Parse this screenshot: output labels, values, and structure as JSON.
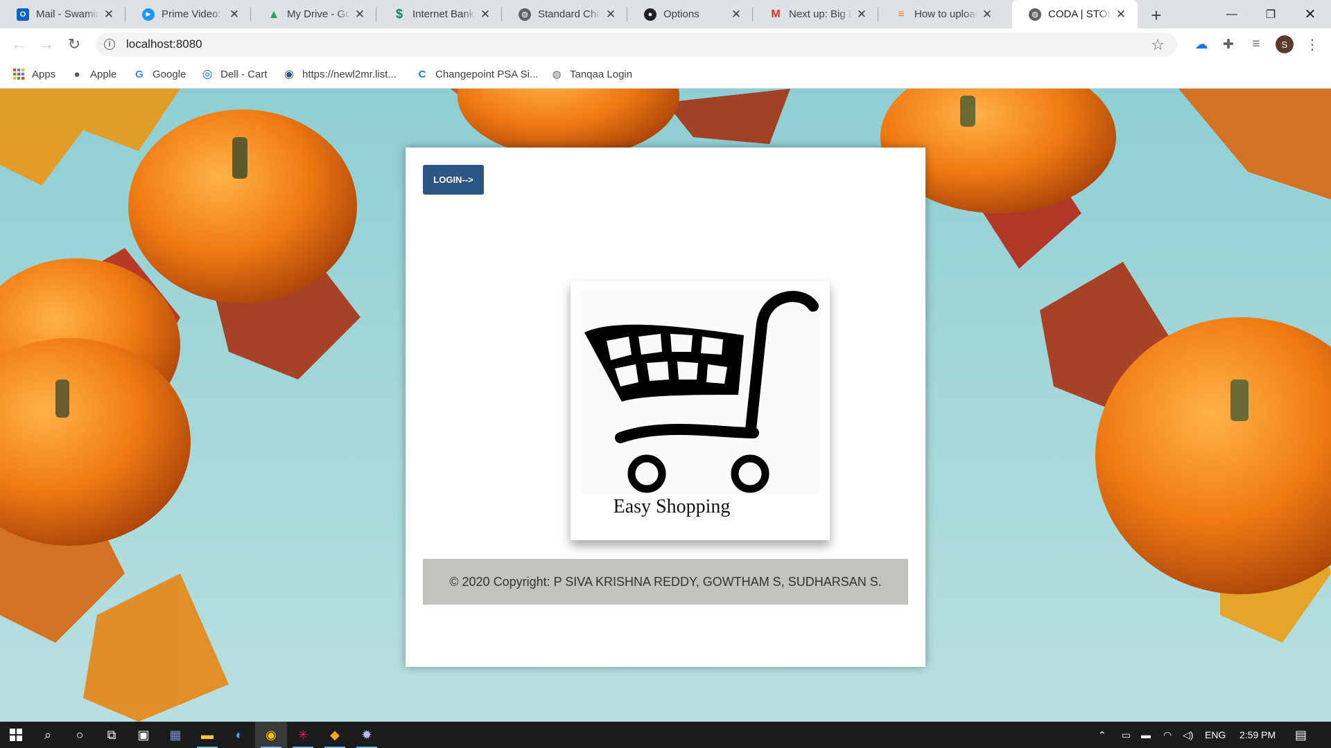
{
  "tabs": [
    {
      "title": "Mail - Swaminathan",
      "icon": "outlook-icon",
      "color": "#0a64c2",
      "glyph": "O"
    },
    {
      "title": "Prime Video: The",
      "icon": "prime-video-icon",
      "color": "#1a98ff",
      "glyph": "▶"
    },
    {
      "title": "My Drive - Google",
      "icon": "google-drive-icon",
      "color": "#1fa463",
      "glyph": "▲"
    },
    {
      "title": "Internet Banking",
      "icon": "bank-icon",
      "color": "#0a8a5a",
      "glyph": "S"
    },
    {
      "title": "Standard Chartered",
      "icon": "globe-icon",
      "color": "#5f6368",
      "glyph": "◍"
    },
    {
      "title": "Options",
      "icon": "github-icon",
      "color": "#202124",
      "glyph": "●"
    },
    {
      "title": "Next up: Big Data",
      "icon": "gmail-icon",
      "color": "#d93025",
      "glyph": "M"
    },
    {
      "title": "How to upload",
      "icon": "stackoverflow-icon",
      "color": "#f48024",
      "glyph": "≡"
    },
    {
      "title": "CODA | STORE",
      "icon": "globe-icon",
      "color": "#5f6368",
      "glyph": "◍",
      "active": true
    }
  ],
  "address_bar": {
    "url": "localhost:8080"
  },
  "bookmarks": [
    {
      "label": "Apps",
      "icon": "apps-grid-icon",
      "color": "#ea4335",
      "glyph": "⋮⋮"
    },
    {
      "label": "Apple",
      "icon": "apple-icon",
      "color": "#555555",
      "glyph": ""
    },
    {
      "label": "Google",
      "icon": "google-icon",
      "color": "#4285f4",
      "glyph": "G"
    },
    {
      "label": "Dell - Cart",
      "icon": "dell-icon",
      "color": "#0076ce",
      "glyph": "◎"
    },
    {
      "label": "https://newl2mr.list...",
      "icon": "site-icon",
      "color": "#2d5683",
      "glyph": "◉"
    },
    {
      "label": "Changepoint PSA Si...",
      "icon": "changepoint-icon",
      "color": "#1d7fb8",
      "glyph": "C"
    },
    {
      "label": "Tanqaa Login",
      "icon": "globe-icon",
      "color": "#5f6368",
      "glyph": "◍"
    }
  ],
  "page": {
    "login_button": "LOGIN-->",
    "logo_text": "Easy Shopping",
    "footer_text": "© 2020 Copyright: P SIVA KRISHNA REDDY, GOWTHAM S, SUDHARSAN S."
  },
  "profile": {
    "initial": "S"
  },
  "taskbar": {
    "language": "ENG",
    "time": "2:59 PM"
  }
}
